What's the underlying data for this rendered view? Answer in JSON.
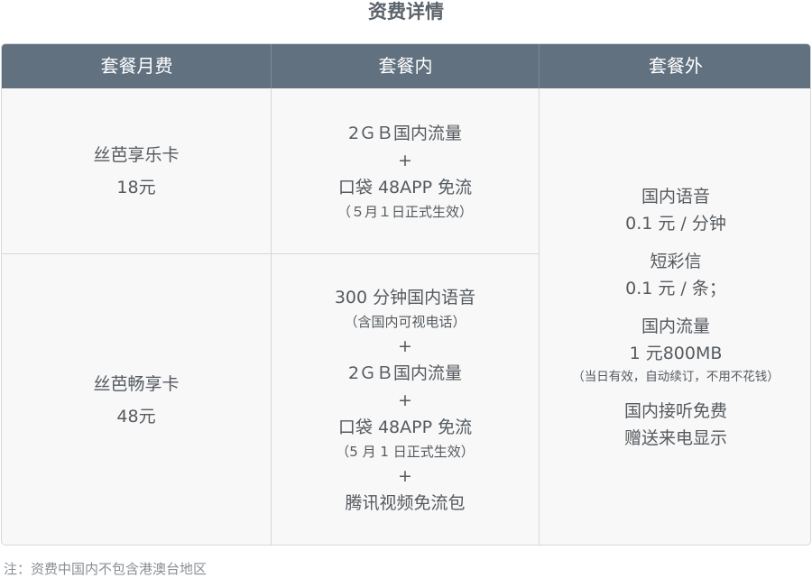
{
  "title": "资费详情",
  "headers": [
    "套餐月费",
    "套餐内",
    "套餐外"
  ],
  "rows": [
    {
      "plan_name": "丝芭享乐卡",
      "price": "18元",
      "included": {
        "line1": "2ＧＢ国内流量",
        "plus1": "+",
        "line2": "口袋 48APP 免流",
        "line2_note": "（５月１日正式生效）"
      }
    },
    {
      "plan_name": "丝芭畅享卡",
      "price": "48元",
      "included": {
        "line1": "300 分钟国内语音",
        "line1_note": "（含国内可视电话）",
        "plus1": "+",
        "line2": "2ＧＢ国内流量",
        "plus2": "+",
        "line3": "口袋 48APP 免流",
        "line3_note": "（5 月 1 日正式生效）",
        "plus3": "+",
        "line4": "腾讯视频免流包"
      }
    }
  ],
  "extra": {
    "voice_label": "国内语音",
    "voice_price": "0.1 元 / 分钟",
    "sms_label": "短彩信",
    "sms_price": "0.1 元 / 条；",
    "data_label": "国内流量",
    "data_price": "1 元800MB",
    "data_note": "（当日有效，自动续订，不用不花钱）",
    "free_answer": "国内接听免费",
    "caller_id": "赠送来电显示"
  },
  "footnote": "注：资费中国内不包含港澳台地区"
}
